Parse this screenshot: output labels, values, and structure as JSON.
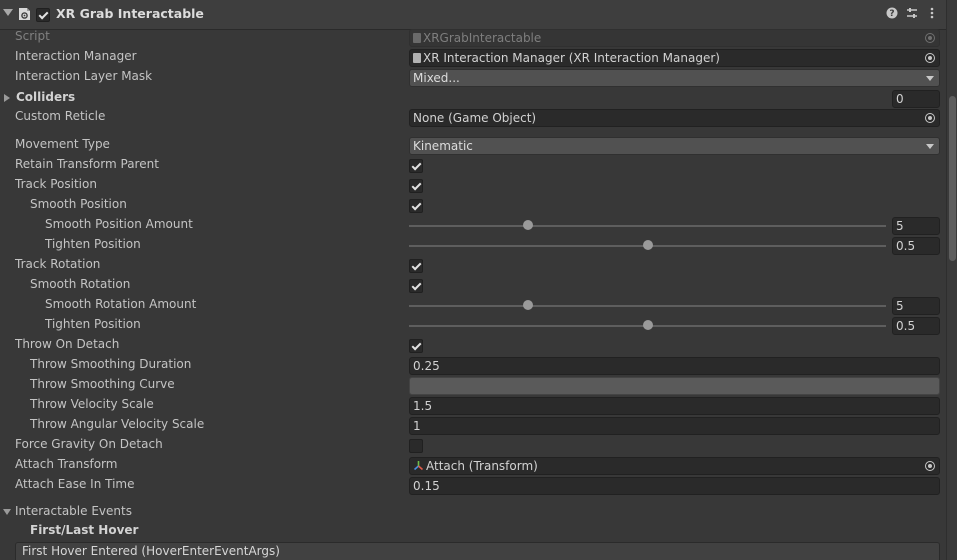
{
  "header": {
    "title": "XR Grab Interactable",
    "enabled": true,
    "help_label": "?",
    "preset_label": "⇅",
    "menu_label": "⋮"
  },
  "fields": {
    "script": {
      "label": "Script",
      "value": "XRGrabInteractable"
    },
    "interaction_manager": {
      "label": "Interaction Manager",
      "value": "XR Interaction Manager (XR Interaction Manager)"
    },
    "interaction_layer_mask": {
      "label": "Interaction Layer Mask",
      "value": "Mixed..."
    },
    "colliders": {
      "label": "Colliders",
      "value": "0"
    },
    "custom_reticle": {
      "label": "Custom Reticle",
      "value": "None (Game Object)"
    },
    "movement_type": {
      "label": "Movement Type",
      "value": "Kinematic"
    },
    "retain_transform_parent": {
      "label": "Retain Transform Parent",
      "checked": true
    },
    "track_position": {
      "label": "Track Position",
      "checked": true
    },
    "smooth_position": {
      "label": "Smooth Position",
      "checked": true
    },
    "smooth_position_amount": {
      "label": "Smooth Position Amount",
      "value": "5",
      "fraction": 0.25
    },
    "tighten_position": {
      "label": "Tighten Position",
      "value": "0.5",
      "fraction": 0.5
    },
    "track_rotation": {
      "label": "Track Rotation",
      "checked": true
    },
    "smooth_rotation": {
      "label": "Smooth Rotation",
      "checked": true
    },
    "smooth_rotation_amount": {
      "label": "Smooth Rotation Amount",
      "value": "5",
      "fraction": 0.25
    },
    "tighten_rotation": {
      "label": "Tighten Position",
      "value": "0.5",
      "fraction": 0.5
    },
    "throw_on_detach": {
      "label": "Throw On Detach",
      "checked": true
    },
    "throw_smoothing_duration": {
      "label": "Throw Smoothing Duration",
      "value": "0.25"
    },
    "throw_smoothing_curve": {
      "label": "Throw Smoothing Curve"
    },
    "throw_velocity_scale": {
      "label": "Throw Velocity Scale",
      "value": "1.5"
    },
    "throw_angular_velocity_scale": {
      "label": "Throw Angular Velocity Scale",
      "value": "1"
    },
    "force_gravity_on_detach": {
      "label": "Force Gravity On Detach",
      "checked": false
    },
    "attach_transform": {
      "label": "Attach Transform",
      "value": "Attach (Transform)"
    },
    "attach_ease_in_time": {
      "label": "Attach Ease In Time",
      "value": "0.15"
    }
  },
  "events": {
    "label": "Interactable Events",
    "section": "First/Last Hover",
    "first_hover_entered": "First Hover Entered (HoverEnterEventArgs)"
  }
}
